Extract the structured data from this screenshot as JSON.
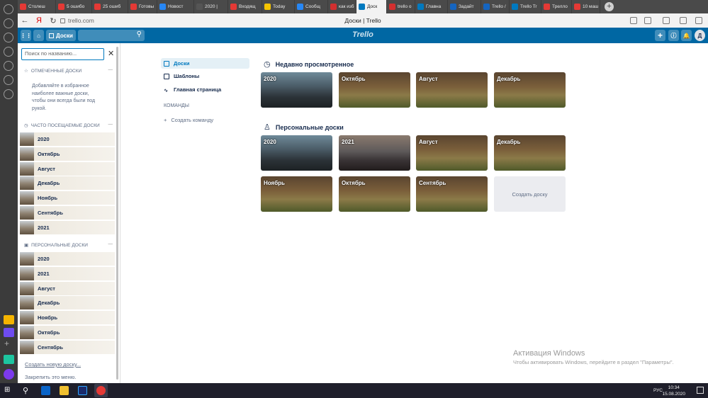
{
  "tabs": [
    {
      "label": "Столеш",
      "color": "#e53935"
    },
    {
      "label": "5 ошибо",
      "color": "#e53935"
    },
    {
      "label": "25 ошиб",
      "color": "#e53935"
    },
    {
      "label": "Готовы",
      "color": "#e53935"
    },
    {
      "label": "Новост",
      "color": "#2787f5"
    },
    {
      "label": "2020 |",
      "color": "#555555"
    },
    {
      "label": "Входящ",
      "color": "#e53935"
    },
    {
      "label": "Today",
      "color": "#f5c400"
    },
    {
      "label": "Сообщ",
      "color": "#2787f5"
    },
    {
      "label": "как изб",
      "color": "#d32f2f"
    },
    {
      "label": "Доск",
      "color": "#0079bf",
      "active": true
    },
    {
      "label": "trello o",
      "color": "#d32f2f"
    },
    {
      "label": "Главна",
      "color": "#0079bf"
    },
    {
      "label": "Задайт",
      "color": "#1565c0"
    },
    {
      "label": "Trello /",
      "color": "#1565c0"
    },
    {
      "label": "Trello Tr",
      "color": "#0079bf"
    },
    {
      "label": "Трелло",
      "color": "#e53935"
    },
    {
      "label": "10 маш",
      "color": "#e53935"
    }
  ],
  "address": {
    "url": "trello.com",
    "page_title": "Доски | Trello"
  },
  "header": {
    "boards_label": "Доски",
    "logo": "Trello",
    "avatar": "Д"
  },
  "sidebar": {
    "search_placeholder": "Поиск по названию...",
    "starred_title": "Отмеченные доски",
    "starred_hint": "Добавляйте в избранное наиболее важные доски, чтобы они всегда были под рукой.",
    "frequent_title": "Часто посещаемые доски",
    "frequent": [
      "2020",
      "Октябрь",
      "Август",
      "Декабрь",
      "Ноябрь",
      "Сентябрь",
      "2021"
    ],
    "personal_title": "Персональные доски",
    "personal": [
      "2020",
      "2021",
      "Август",
      "Декабрь",
      "Ноябрь",
      "Октябрь",
      "Сентябрь"
    ],
    "create_link": "Создать новую доску...",
    "pin_text": "Закрепить это меню."
  },
  "mainnav": {
    "boards": "Доски",
    "templates": "Шаблоны",
    "home": "Главная страница",
    "teams_title": "КОМАНДЫ",
    "create_team": "Создать команду"
  },
  "recent": {
    "title": "Недавно просмотренное",
    "boards": [
      "2020",
      "Октябрь",
      "Август",
      "Декабрь"
    ]
  },
  "personal": {
    "title": "Персональные доски",
    "boards": [
      "2020",
      "2021",
      "Август",
      "Декабрь",
      "Ноябрь",
      "Октябрь",
      "Сентябрь"
    ],
    "create_label": "Создать доску"
  },
  "watermark": {
    "line1": "Активация Windows",
    "line2": "Чтобы активировать Windows, перейдите в раздел \"Параметры\"."
  },
  "taskbar": {
    "time": "10:34",
    "date": "15.08.2020",
    "lang": "РУС"
  },
  "colors": {
    "header_blue": "#0067a3",
    "accent": "#0079bf"
  }
}
